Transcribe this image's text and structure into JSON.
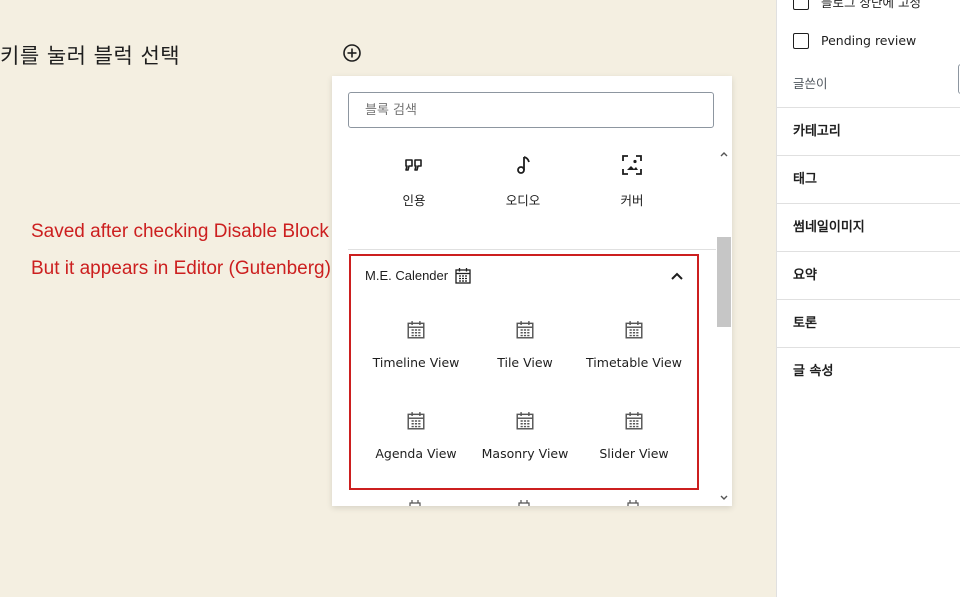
{
  "editor": {
    "placeholder_text": "키를 눌러 블럭 선택",
    "annotation_line1": "Saved after checking Disable Block Editor.",
    "annotation_line2": "But it appears in Editor (Gutenberg)"
  },
  "inserter": {
    "search_placeholder": "블록 검색",
    "common_blocks": [
      {
        "label": "인용",
        "icon": "quote-icon"
      },
      {
        "label": "오디오",
        "icon": "audio-icon"
      },
      {
        "label": "커버",
        "icon": "cover-icon"
      }
    ],
    "category": {
      "title": "M.E. Calender",
      "icon": "calendar-icon",
      "expanded": true,
      "blocks": [
        {
          "label": "Timeline View",
          "icon": "calendar-icon"
        },
        {
          "label": "Tile View",
          "icon": "calendar-icon"
        },
        {
          "label": "Timetable View",
          "icon": "calendar-icon"
        },
        {
          "label": "Agenda View",
          "icon": "calendar-icon"
        },
        {
          "label": "Masonry View",
          "icon": "calendar-icon"
        },
        {
          "label": "Slider View",
          "icon": "calendar-icon"
        }
      ]
    }
  },
  "sidebar": {
    "sticky_label": "블로그 상단에 고정",
    "pending_review_label": "Pending review",
    "author_label": "글쓴이",
    "panels": [
      "카테고리",
      "태그",
      "썸네일이미지",
      "요약",
      "토론",
      "글 속성"
    ]
  },
  "colors": {
    "editor_background": "#f4efe1",
    "annotation": "#cc1f1f",
    "highlight_border": "#cc1f1f"
  }
}
